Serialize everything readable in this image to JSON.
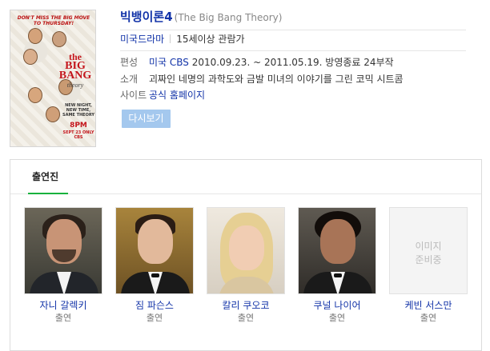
{
  "poster": {
    "tagline": "DON'T MISS THE BIG MOVE TO THURSDAY!",
    "logo_line1": "the",
    "logo_line2": "BIG BANG",
    "logo_line3": "theory",
    "promo": "NEW NIGHT, NEW TIME, SAME THEORY",
    "time": "8PM",
    "date": "SEPT 23 ONLY CBS"
  },
  "show": {
    "title": "빅뱅이론4",
    "subtitle": "(The Big Bang Theory)",
    "genre": "미국드라마",
    "rating": "15세이상 관람가"
  },
  "meta": [
    {
      "label": "편성",
      "link": "미국 CBS",
      "value": " 2010.09.23. ~ 2011.05.19. 방영종료 24부작"
    },
    {
      "label": "소개",
      "link": "",
      "value": "괴짜인 네명의 과학도와 금발 미녀의 이야기를 그린 코믹 시트콤"
    },
    {
      "label": "사이트",
      "link": "공식 홈페이지",
      "value": ""
    }
  ],
  "replay_button": "다시보기",
  "cast": {
    "tab_label": "출연진",
    "people": [
      {
        "name": "자니 갈렉키",
        "role": "출연"
      },
      {
        "name": "짐 파슨스",
        "role": "출연"
      },
      {
        "name": "칼리 쿠오코",
        "role": "출연"
      },
      {
        "name": "쿠널 나이어",
        "role": "출연"
      },
      {
        "name": "케빈 서스만",
        "role": "출연",
        "placeholder_line1": "이미지",
        "placeholder_line2": "준비중"
      }
    ]
  }
}
